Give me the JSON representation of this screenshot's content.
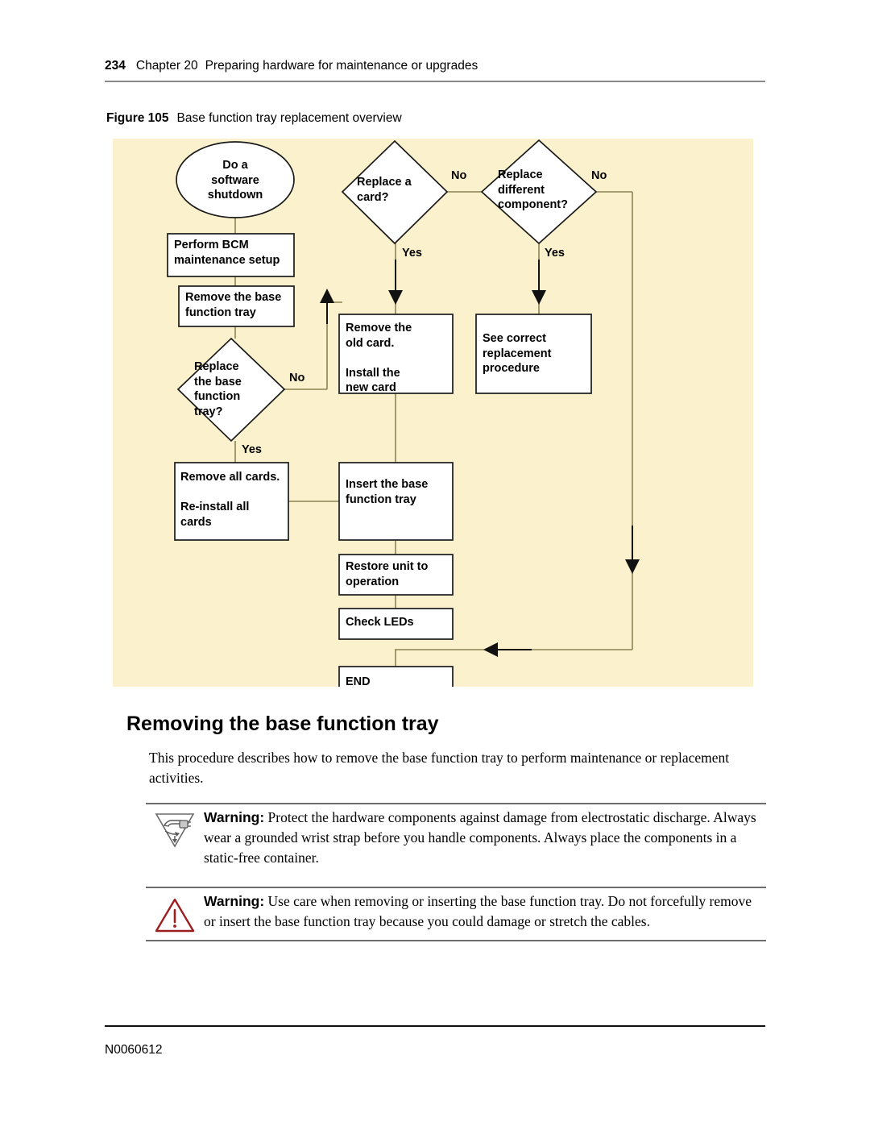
{
  "page": {
    "number": "234",
    "chapter": "Chapter 20",
    "chapter_title": "Preparing hardware for maintenance or upgrades",
    "footer_doc_id": "N0060612"
  },
  "figure": {
    "label": "Figure 105",
    "caption": "Base function tray replacement overview",
    "background_color": "#fbf1cd",
    "node_fill": "#ffffff",
    "node_stroke": "#1a1a1a",
    "connector_color": "#8b8455"
  },
  "flowchart": {
    "nodes": {
      "start": "Do a\nsoftware\nshutdown",
      "perform_bcm": "Perform BCM\nmaintenance setup",
      "remove_tray": "Remove the base\nfunction tray",
      "replace_tray_decision": "Replace\nthe base\nfunction\ntray?",
      "remove_all_cards": "Remove all cards.\n\nRe-install all\ncards",
      "replace_card_decision": "Replace a\ncard?",
      "replace_component_decision": "Replace\ndifferent\ncomponent?",
      "remove_old_card": "Remove the\nold card.\n\nInstall the\nnew card",
      "see_procedure": "See correct\nreplacement\nprocedure",
      "insert_tray": "Insert the base\nfunction tray",
      "restore_unit": "Restore unit to\noperation",
      "check_leds": "Check LEDs",
      "end": "END"
    },
    "edge_labels": {
      "replace_tray_no": "No",
      "replace_tray_yes": "Yes",
      "replace_card_no": "No",
      "replace_card_yes": "Yes",
      "replace_component_no": "No",
      "replace_component_yes": "Yes"
    }
  },
  "section": {
    "heading": "Removing the base function tray",
    "intro": "This procedure describes how to remove the base function tray to perform maintenance or replacement activities."
  },
  "warnings": [
    {
      "icon": "esd-warning-icon",
      "label": "Warning:",
      "text": " Protect the hardware components against damage from electrostatic discharge. Always wear a grounded wrist strap before you handle components. Always place the components in a static-free container."
    },
    {
      "icon": "caution-triangle-icon",
      "label": "Warning:",
      "text": " Use care when removing or inserting the base function tray. Do not forcefully remove or insert the base function tray because you could damage or stretch the cables.",
      "icon_color": "#9c1f1f"
    }
  ]
}
